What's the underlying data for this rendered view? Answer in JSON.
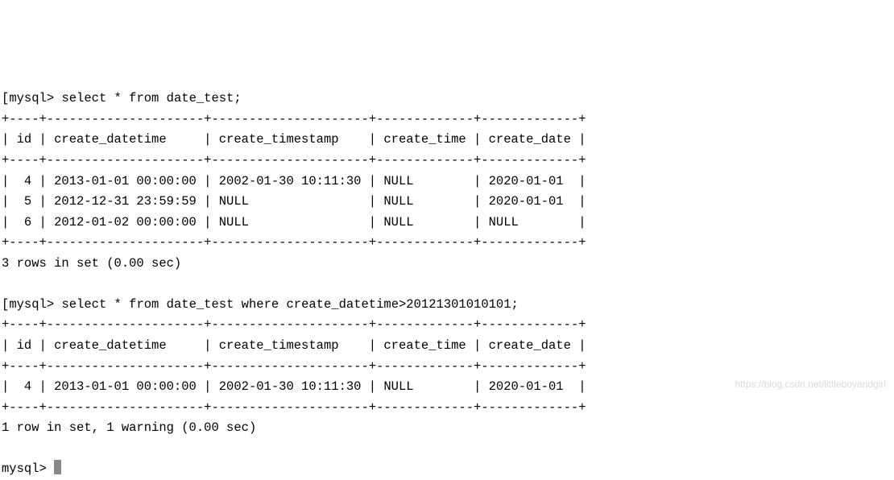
{
  "prompt": "mysql> ",
  "bracket": "[",
  "query1": {
    "sql": "select * from date_test;",
    "border_top": "+----+---------------------+---------------------+-------------+-------------+",
    "header": "| id | create_datetime     | create_timestamp    | create_time | create_date |",
    "border_mid": "+----+---------------------+---------------------+-------------+-------------+",
    "rows": [
      "|  4 | 2013-01-01 00:00:00 | 2002-01-30 10:11:30 | NULL        | 2020-01-01  |",
      "|  5 | 2012-12-31 23:59:59 | NULL                | NULL        | 2020-01-01  |",
      "|  6 | 2012-01-02 00:00:00 | NULL                | NULL        | NULL        |"
    ],
    "border_bot": "+----+---------------------+---------------------+-------------+-------------+",
    "status": "3 rows in set (0.00 sec)"
  },
  "query2": {
    "sql": "select * from date_test where create_datetime>20121301010101;",
    "border_top": "+----+---------------------+---------------------+-------------+-------------+",
    "header": "| id | create_datetime     | create_timestamp    | create_time | create_date |",
    "border_mid": "+----+---------------------+---------------------+-------------+-------------+",
    "rows": [
      "|  4 | 2013-01-01 00:00:00 | 2002-01-30 10:11:30 | NULL        | 2020-01-01  |"
    ],
    "border_bot": "+----+---------------------+---------------------+-------------+-------------+",
    "status": "1 row in set, 1 warning (0.00 sec)"
  },
  "chart_data": {
    "type": "table",
    "result1": {
      "columns": [
        "id",
        "create_datetime",
        "create_timestamp",
        "create_time",
        "create_date"
      ],
      "rows": [
        {
          "id": 4,
          "create_datetime": "2013-01-01 00:00:00",
          "create_timestamp": "2002-01-30 10:11:30",
          "create_time": null,
          "create_date": "2020-01-01"
        },
        {
          "id": 5,
          "create_datetime": "2012-12-31 23:59:59",
          "create_timestamp": null,
          "create_time": null,
          "create_date": "2020-01-01"
        },
        {
          "id": 6,
          "create_datetime": "2012-01-02 00:00:00",
          "create_timestamp": null,
          "create_time": null,
          "create_date": null
        }
      ],
      "row_count": 3,
      "elapsed_sec": 0.0
    },
    "result2": {
      "columns": [
        "id",
        "create_datetime",
        "create_timestamp",
        "create_time",
        "create_date"
      ],
      "rows": [
        {
          "id": 4,
          "create_datetime": "2013-01-01 00:00:00",
          "create_timestamp": "2002-01-30 10:11:30",
          "create_time": null,
          "create_date": "2020-01-01"
        }
      ],
      "row_count": 1,
      "warnings": 1,
      "elapsed_sec": 0.0
    }
  },
  "watermark": "https://blog.csdn.net/littleboyandgirl"
}
